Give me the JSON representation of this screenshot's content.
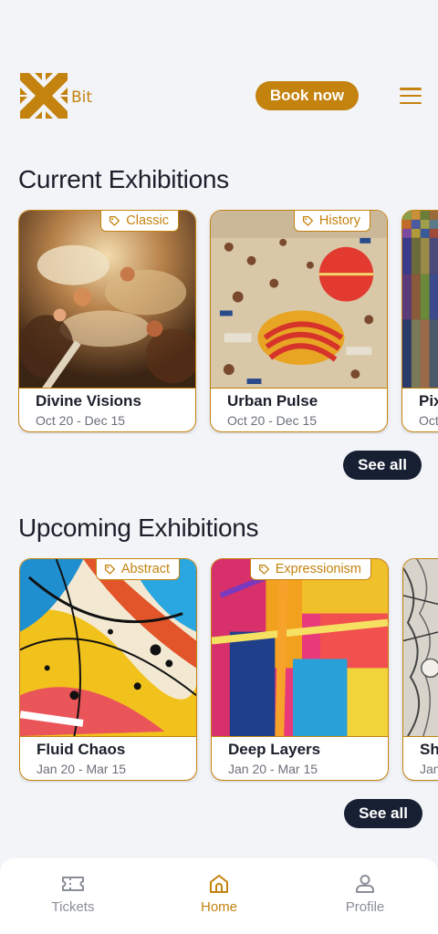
{
  "header": {
    "logo_text": "Bit",
    "book_label": "Book now"
  },
  "current": {
    "title": "Current Exhibitions",
    "see_all": "See all",
    "cards": [
      {
        "tag": "Classic",
        "title": "Divine Visions",
        "date": "Oct 20 - Dec 15"
      },
      {
        "tag": "History",
        "title": "Urban Pulse",
        "date": "Oct 20 - Dec 15"
      },
      {
        "tag": "",
        "title": "Pix",
        "date": "Oct"
      }
    ]
  },
  "upcoming": {
    "title": "Upcoming Exhibitions",
    "see_all": "See all",
    "cards": [
      {
        "tag": "Abstract",
        "title": "Fluid Chaos",
        "date": "Jan 20 - Mar 15"
      },
      {
        "tag": "Expressionism",
        "title": "Deep Layers",
        "date": "Jan 20 - Mar 15"
      },
      {
        "tag": "",
        "title": "Sh",
        "date": "Jan"
      }
    ]
  },
  "nav": {
    "items": [
      {
        "label": "Tickets",
        "icon": "ticket-icon"
      },
      {
        "label": "Home",
        "icon": "home-icon"
      },
      {
        "label": "Profile",
        "icon": "person-icon"
      }
    ],
    "active": "Home"
  },
  "colors": {
    "accent": "#c4820f",
    "dark": "#172033",
    "background": "#f3f4f8"
  }
}
